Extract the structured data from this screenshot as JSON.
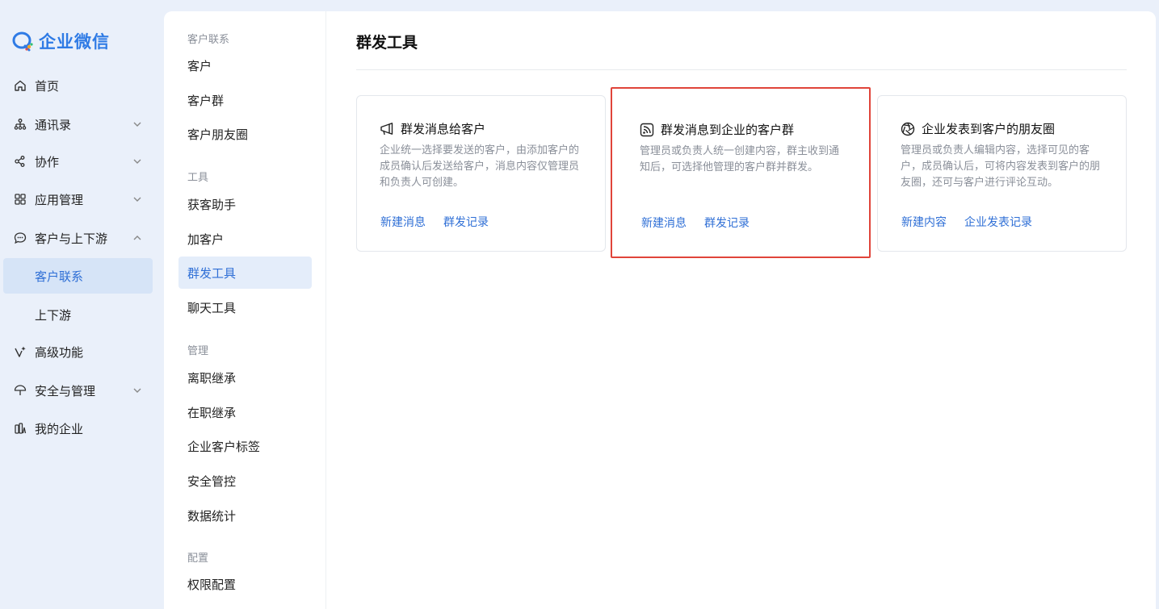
{
  "app": {
    "logo_text": "企业微信"
  },
  "nav": {
    "items": [
      {
        "label": "首页",
        "icon": "home-icon"
      },
      {
        "label": "通讯录",
        "icon": "org-chart-icon"
      },
      {
        "label": "协作",
        "icon": "collab-icon"
      },
      {
        "label": "应用管理",
        "icon": "apps-grid-icon"
      },
      {
        "label": "客户与上下游",
        "icon": "chat-icon"
      },
      {
        "label": "客户联系"
      },
      {
        "label": "上下游"
      },
      {
        "label": "高级功能",
        "icon": "sparkle-icon"
      },
      {
        "label": "安全与管理",
        "icon": "umbrella-icon"
      },
      {
        "label": "我的企业",
        "icon": "building-icon"
      }
    ]
  },
  "subnav": {
    "groups": [
      {
        "title": "客户联系",
        "items": [
          "客户",
          "客户群",
          "客户朋友圈"
        ]
      },
      {
        "title": "工具",
        "items": [
          "获客助手",
          "加客户",
          "群发工具",
          "聊天工具"
        ]
      },
      {
        "title": "管理",
        "items": [
          "离职继承",
          "在职继承",
          "企业客户标签",
          "安全管控",
          "数据统计"
        ]
      },
      {
        "title": "配置",
        "items": [
          "权限配置"
        ]
      }
    ],
    "active": "群发工具"
  },
  "main": {
    "title": "群发工具",
    "cards": [
      {
        "title": "群发消息给客户",
        "icon": "megaphone-icon",
        "desc": "企业统一选择要发送的客户，由添加客户的成员确认后发送给客户，消息内容仅管理员和负责人可创建。",
        "links": [
          "新建消息",
          "群发记录"
        ]
      },
      {
        "title": "群发消息到企业的客户群",
        "icon": "broadcast-icon",
        "desc": "管理员或负责人统一创建内容，群主收到通知后，可选择他管理的客户群并群发。",
        "links": [
          "新建消息",
          "群发记录"
        ]
      },
      {
        "title": "企业发表到客户的朋友圈",
        "icon": "aperture-icon",
        "desc": "管理员或负责人编辑内容，选择可见的客户，成员确认后，可将内容发表到客户的朋友圈，还可与客户进行评论互动。",
        "links": [
          "新建内容",
          "企业发表记录"
        ]
      }
    ]
  },
  "colors": {
    "accent": "#2f6fd6",
    "highlight_border": "#e0443a",
    "nav_bg": "#eaf0fa"
  }
}
